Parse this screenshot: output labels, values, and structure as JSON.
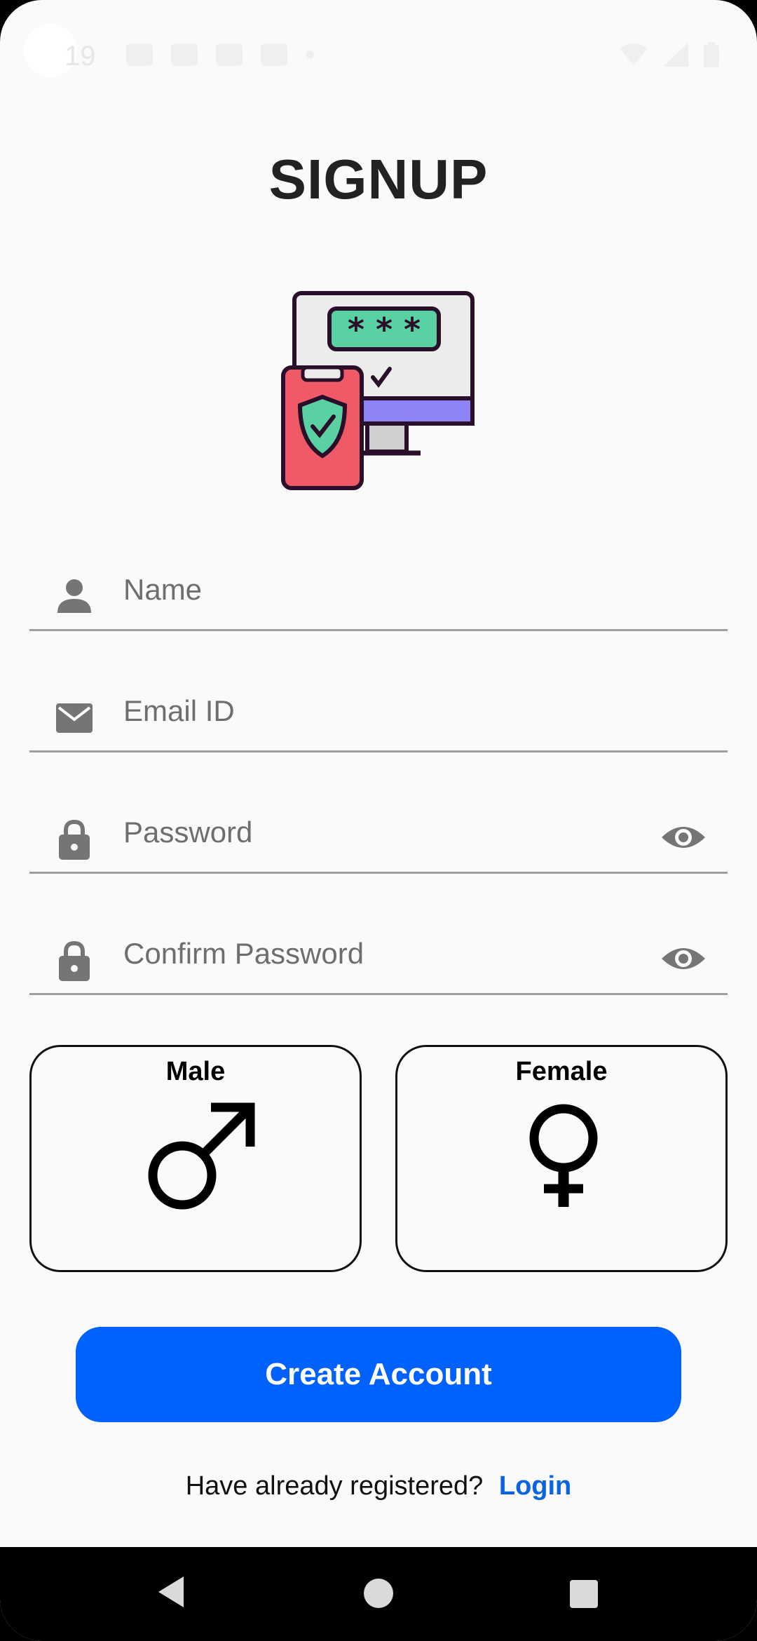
{
  "status_bar": {
    "time": "19"
  },
  "page": {
    "title": "SIGNUP"
  },
  "fields": {
    "name": {
      "placeholder": "Name",
      "icon": "person-icon"
    },
    "email": {
      "placeholder": "Email ID",
      "icon": "mail-icon"
    },
    "password": {
      "placeholder": "Password",
      "icon": "lock-icon"
    },
    "confirm_password": {
      "placeholder": "Confirm Password",
      "icon": "lock-icon"
    }
  },
  "gender": {
    "male_label": "Male",
    "female_label": "Female"
  },
  "actions": {
    "create_account": "Create Account",
    "login_prompt": "Have already registered?",
    "login_link": "Login"
  },
  "colors": {
    "primary": "#0061fc",
    "link": "#0a63e0",
    "background": "#fafafa"
  }
}
